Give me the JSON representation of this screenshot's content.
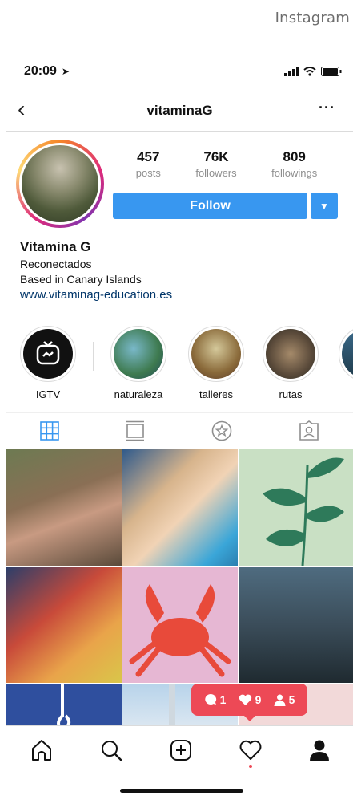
{
  "caption": "Instagram",
  "status": {
    "time": "20:09"
  },
  "nav": {
    "title": "vitaminaG",
    "more": "···"
  },
  "stats": [
    {
      "num": "457",
      "label": "posts"
    },
    {
      "num": "76K",
      "label": "followers"
    },
    {
      "num": "809",
      "label": "followings"
    }
  ],
  "buttons": {
    "follow": "Follow"
  },
  "bio": {
    "name": "Vitamina G",
    "line1": "Reconectados",
    "line2": "Based in Canary Islands",
    "link": "www.vitaminag-education.es"
  },
  "highlights": [
    {
      "label": "IGTV"
    },
    {
      "label": "naturaleza"
    },
    {
      "label": "talleres"
    },
    {
      "label": "rutas"
    }
  ],
  "notifications": {
    "comments": "1",
    "likes": "9",
    "follows": "5"
  },
  "colors": {
    "accent": "#3897f0",
    "notification": "#ed4956"
  }
}
